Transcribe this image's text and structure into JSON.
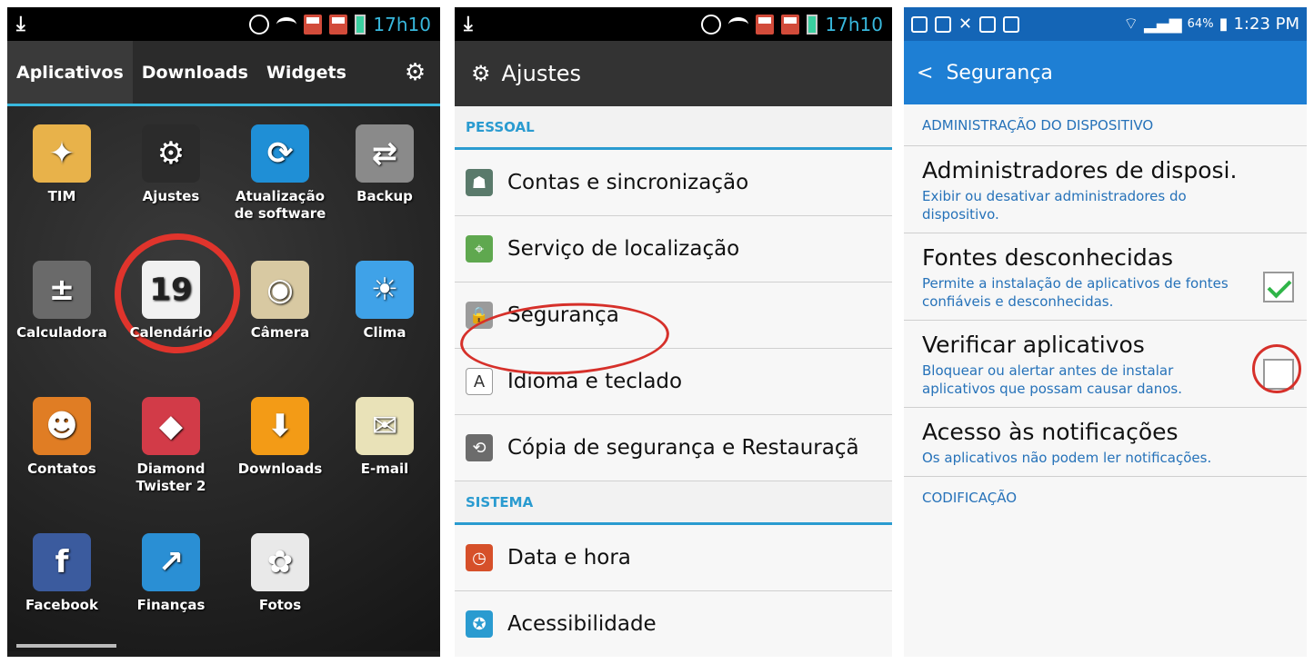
{
  "panel1": {
    "status_time": "17h10",
    "tabs": [
      "Aplicativos",
      "Downloads",
      "Widgets"
    ],
    "apps": [
      {
        "label": "TIM",
        "icon": "tim-icon",
        "color": "#e8b24a"
      },
      {
        "label": "Ajustes",
        "icon": "gear-icon",
        "color": "#2b2b2b"
      },
      {
        "label": "Atualização de software",
        "icon": "refresh-icon",
        "color": "#1f8fd6"
      },
      {
        "label": "Backup",
        "icon": "backup-icon",
        "color": "#8a8a8a"
      },
      {
        "label": "Calculadora",
        "icon": "calculator-icon",
        "color": "#6a6a6a"
      },
      {
        "label": "Calendário",
        "icon": "calendar-icon",
        "color": "#f1f1f1",
        "text": "19"
      },
      {
        "label": "Câmera",
        "icon": "camera-icon",
        "color": "#d8c9a2"
      },
      {
        "label": "Clima",
        "icon": "weather-icon",
        "color": "#3fa2e8"
      },
      {
        "label": "Contatos",
        "icon": "contacts-icon",
        "color": "#e07d24"
      },
      {
        "label": "Diamond Twister 2",
        "icon": "diamond-icon",
        "color": "#d23b48"
      },
      {
        "label": "Downloads",
        "icon": "download-icon",
        "color": "#f39b16"
      },
      {
        "label": "E-mail",
        "icon": "email-icon",
        "color": "#e9e2b8"
      },
      {
        "label": "Facebook",
        "icon": "facebook-icon",
        "color": "#3b5b9e"
      },
      {
        "label": "Finanças",
        "icon": "finance-icon",
        "color": "#2a8fd4"
      },
      {
        "label": "Fotos",
        "icon": "photos-icon",
        "color": "#e9e9e9"
      }
    ]
  },
  "panel2": {
    "status_time": "17h10",
    "title": "Ajustes",
    "section_pessoal": "PESSOAL",
    "items_pessoal": [
      {
        "label": "Contas e sincronização",
        "icon": "accounts-icon",
        "color": "#5a7a6b"
      },
      {
        "label": "Serviço de localização",
        "icon": "location-icon",
        "color": "#5fa84f"
      },
      {
        "label": "Segurança",
        "icon": "lock-icon",
        "color": "#9b9b9b"
      },
      {
        "label": "Idioma e teclado",
        "icon": "language-icon",
        "color": "#ffffff"
      },
      {
        "label": "Cópia de segurança e Restauraçã",
        "icon": "backup-icon",
        "color": "#6c6c6c"
      }
    ],
    "section_sistema": "SISTEMA",
    "items_sistema": [
      {
        "label": "Data e hora",
        "icon": "clock-icon",
        "color": "#d6502a"
      },
      {
        "label": "Acessibilidade",
        "icon": "accessibility-icon",
        "color": "#2a9bd0"
      }
    ]
  },
  "panel3": {
    "status_time": "1:23 PM",
    "battery": "64%",
    "title": "Segurança",
    "section_admin": "ADMINISTRAÇÃO DO DISPOSITIVO",
    "items": [
      {
        "title": "Administradores de disposi.",
        "desc": "Exibir ou desativar administradores do dispositivo.",
        "checkbox": null
      },
      {
        "title": "Fontes desconhecidas",
        "desc": "Permite a instalação de aplicativos de fontes confiáveis e desconhecidas.",
        "checkbox": true
      },
      {
        "title": "Verificar aplicativos",
        "desc": "Bloquear ou alertar antes de instalar aplicativos que possam causar danos.",
        "checkbox": false
      },
      {
        "title": "Acesso às notificações",
        "desc": "Os aplicativos não podem ler notificações.",
        "checkbox": null
      }
    ],
    "section_codificacao": "CODIFICAÇÃO"
  }
}
